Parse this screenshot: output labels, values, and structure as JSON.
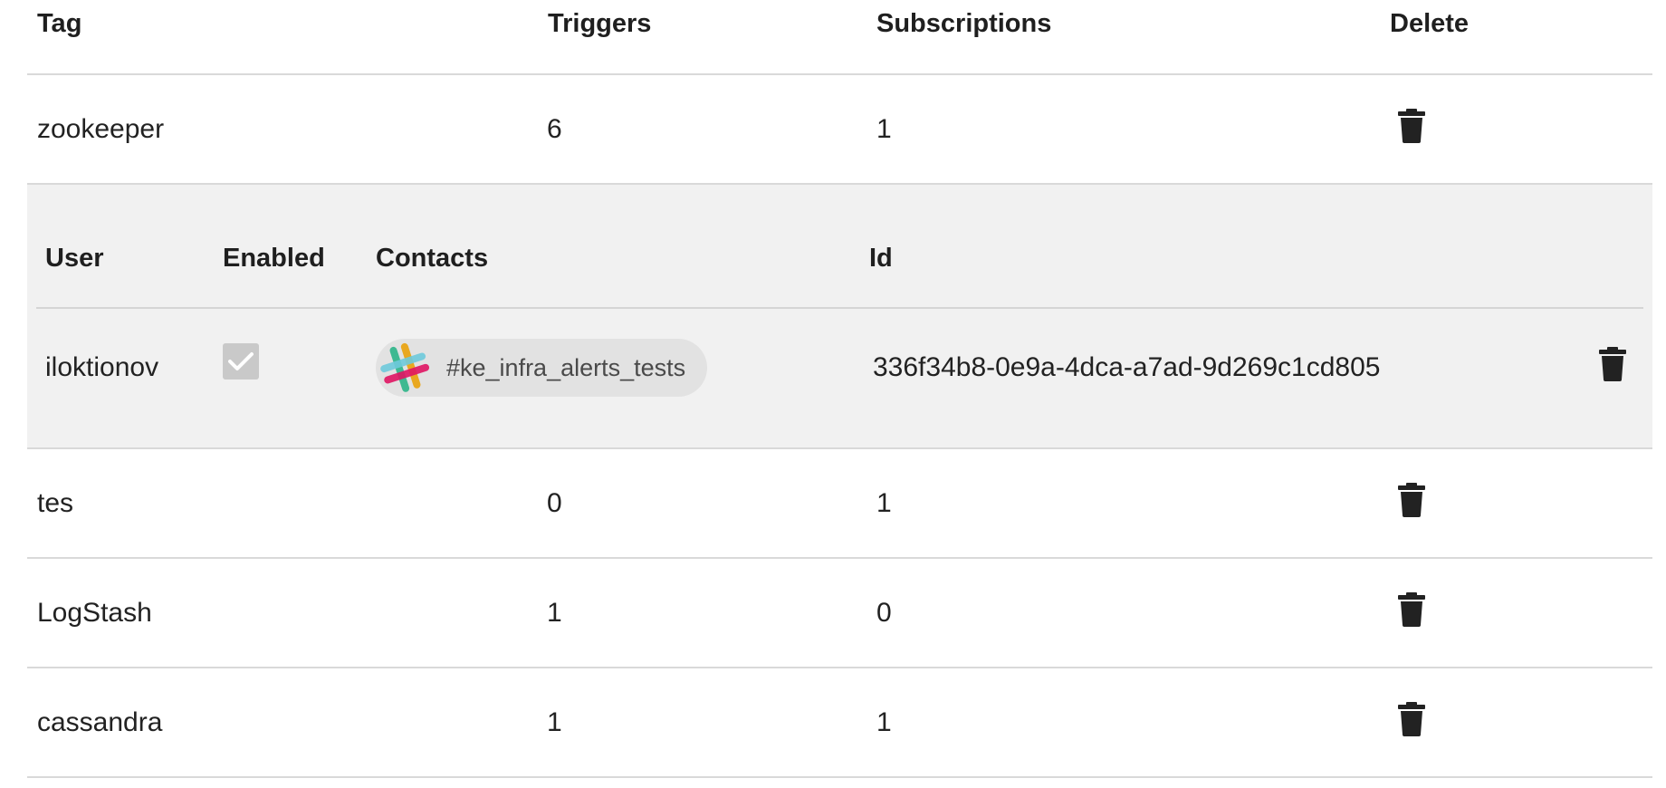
{
  "table": {
    "headers": {
      "tag": "Tag",
      "triggers": "Triggers",
      "subscriptions": "Subscriptions",
      "delete": "Delete"
    },
    "rows": [
      {
        "tag": "zookeeper",
        "triggers": "6",
        "subscriptions": "1"
      },
      {
        "tag": "tes",
        "triggers": "0",
        "subscriptions": "1"
      },
      {
        "tag": "LogStash",
        "triggers": "1",
        "subscriptions": "0"
      },
      {
        "tag": "cassandra",
        "triggers": "1",
        "subscriptions": "1"
      }
    ]
  },
  "subscriptions_panel": {
    "headers": {
      "user": "User",
      "enabled": "Enabled",
      "contacts": "Contacts",
      "id": "Id"
    },
    "rows": [
      {
        "user": "iloktionov",
        "enabled": true,
        "contact": {
          "type": "slack",
          "icon": "slack-icon",
          "label": "#ke_infra_alerts_tests"
        },
        "id": "336f34b8-0e9a-4dca-a7ad-9d269c1cd805"
      }
    ]
  },
  "icons": {
    "delete": "trash-icon",
    "check": "checkmark-icon"
  },
  "colors": {
    "expanded_background": "#f1f1f1",
    "chip_background": "#e2e2e2",
    "checkbox_background": "#c9c9c9",
    "divider": "#d9d9d9"
  }
}
